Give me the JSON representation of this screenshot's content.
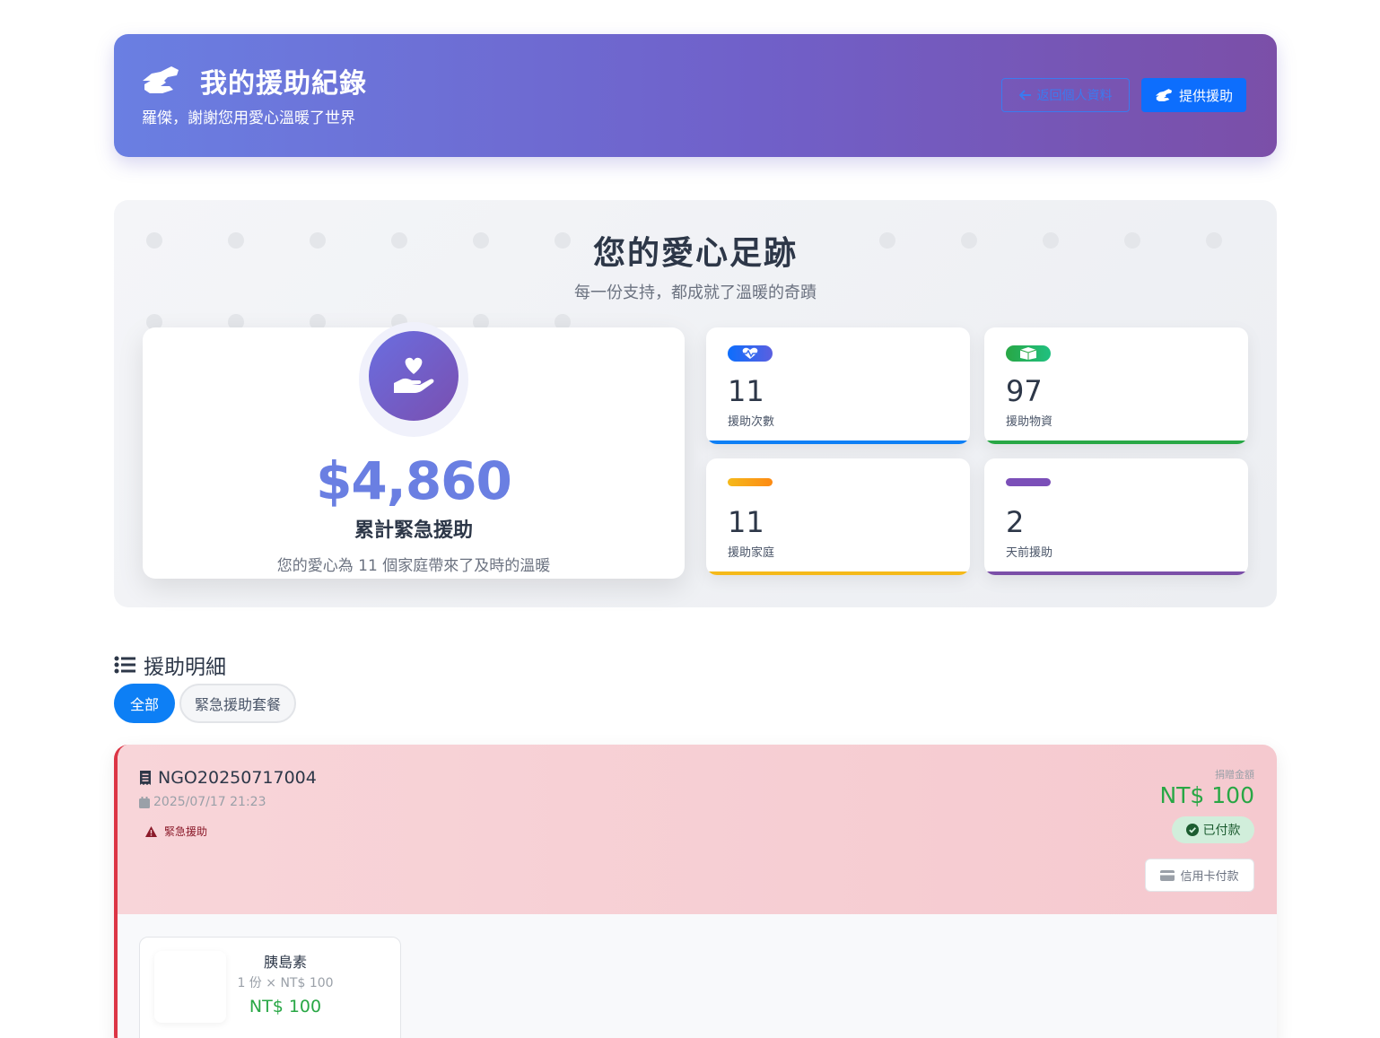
{
  "colors": {
    "header_gradient_start": "#6a7fe2",
    "header_gradient_end": "#7b4fa8",
    "primary": "#0d6efd",
    "amount_text": "#6a7fe2",
    "success": "#28a745",
    "urgent": "#dc3545",
    "stat_blue": "#0d7ff5",
    "stat_green": "#28a745",
    "stat_yellow": "#f5b91a",
    "stat_purple": "#7b4fa8"
  },
  "header": {
    "icon": "hand-holding-heart-icon",
    "title": "我的援助紀錄",
    "subtitle": "羅傑，謝謝您用愛心溫暖了世界",
    "back_button": "返回個人資料",
    "give_button": "提供援助"
  },
  "summary": {
    "title": "您的愛心足跡",
    "subtitle": "每一份支持，都成就了溫暖的奇蹟",
    "total": {
      "amount": "$4,860",
      "label": "累計緊急援助",
      "description": "您的愛心為 11 個家庭帶來了及時的溫暖"
    },
    "stats": [
      {
        "value": "11",
        "label": "援助次數",
        "icon": "heartbeat-icon"
      },
      {
        "value": "97",
        "label": "援助物資",
        "icon": "box-open-icon"
      },
      {
        "value": "11",
        "label": "援助家庭",
        "icon": ""
      },
      {
        "value": "2",
        "label": "天前援助",
        "icon": ""
      }
    ]
  },
  "details": {
    "heading": "援助明細",
    "tabs": [
      "全部",
      "緊急援助套餐"
    ],
    "active_tab": "全部",
    "orders": [
      {
        "order_no": "NGO20250717004",
        "date": "2025/07/17 21:23",
        "type": "緊急援助",
        "amount_label": "捐贈金額",
        "amount": "NT$ 100",
        "status": "已付款",
        "payment_method": "信用卡付款",
        "items": [
          {
            "name": "胰島素",
            "qty_price": "1 份 × NT$ 100",
            "subtotal": "NT$ 100"
          }
        ]
      }
    ]
  }
}
